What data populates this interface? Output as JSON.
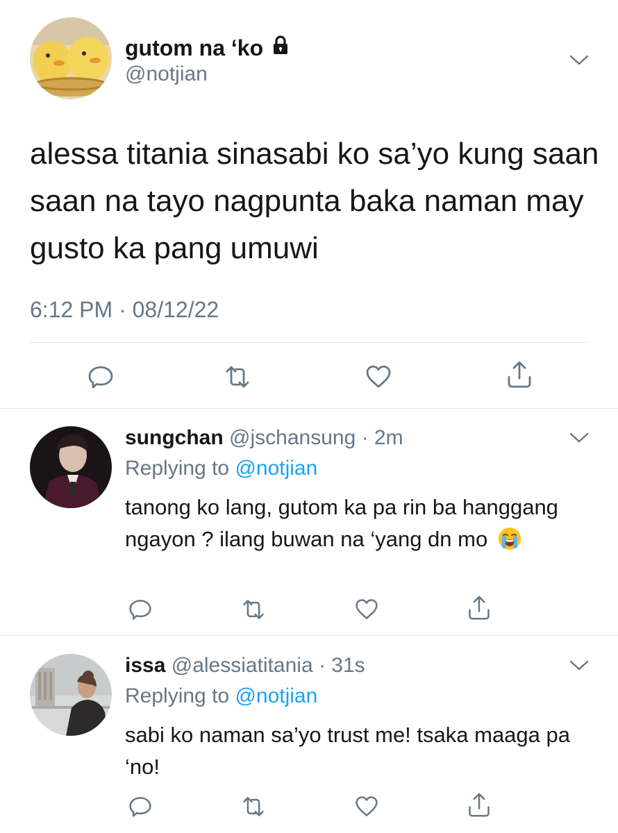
{
  "main_tweet": {
    "display_name": "gutom na ‘ko",
    "handle": "@notjian",
    "text": "alessa titania sinasabi ko sa’yo kung saan saan na tayo nagpunta baka naman may gusto ka pang umuwi",
    "timestamp": "6:12 PM · 08/12/22",
    "icons": {
      "lock": "lock-icon",
      "more": "chevron-down-icon",
      "reply": "reply-icon",
      "retweet": "retweet-icon",
      "like": "heart-icon",
      "share": "share-icon"
    }
  },
  "replies": [
    {
      "display_name": "sungchan",
      "handle": "@jschansung",
      "time": "· 2m",
      "replying_prefix": "Replying to ",
      "replying_to": "@notjian",
      "text": "tanong ko lang, gutom ka pa rin ba hanggang ngayon ? ilang buwan na ‘yang dn mo",
      "emoji": "loudly-crying-face"
    },
    {
      "display_name": "issa",
      "handle": "@alessiatitania",
      "time": "· 31s",
      "replying_prefix": "Replying to ",
      "replying_to": "@notjian",
      "text": "sabi ko naman sa’yo trust me! tsaka maaga pa ‘no!"
    }
  ],
  "colors": {
    "text": "#14171a",
    "secondary": "#657786",
    "link": "#1da1f2",
    "divider": "#e1e8ed"
  }
}
